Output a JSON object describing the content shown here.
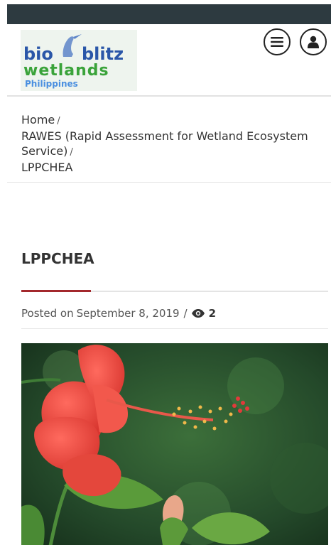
{
  "logo": {
    "line1": "bio blitz",
    "line2": "wetlands",
    "line3": "Philippines"
  },
  "header": {
    "menu_icon": "hamburger-menu-icon",
    "user_icon": "user-icon"
  },
  "breadcrumb": {
    "items": [
      "Home",
      "RAWES (Rapid Assessment for Wetland Ecosystem Service)",
      "LPPCHEA"
    ],
    "separator": "/"
  },
  "post": {
    "title": "LPPCHEA",
    "posted_prefix": "Posted on",
    "date": "September 8, 2019",
    "separator": "/",
    "views": "2",
    "views_icon": "eye-icon",
    "image_subject": "red hibiscus flower"
  },
  "colors": {
    "accent": "#a3282c",
    "status_bar": "#2d3a40",
    "logo_blue": "#2a56a8",
    "logo_green": "#3aa33a"
  }
}
